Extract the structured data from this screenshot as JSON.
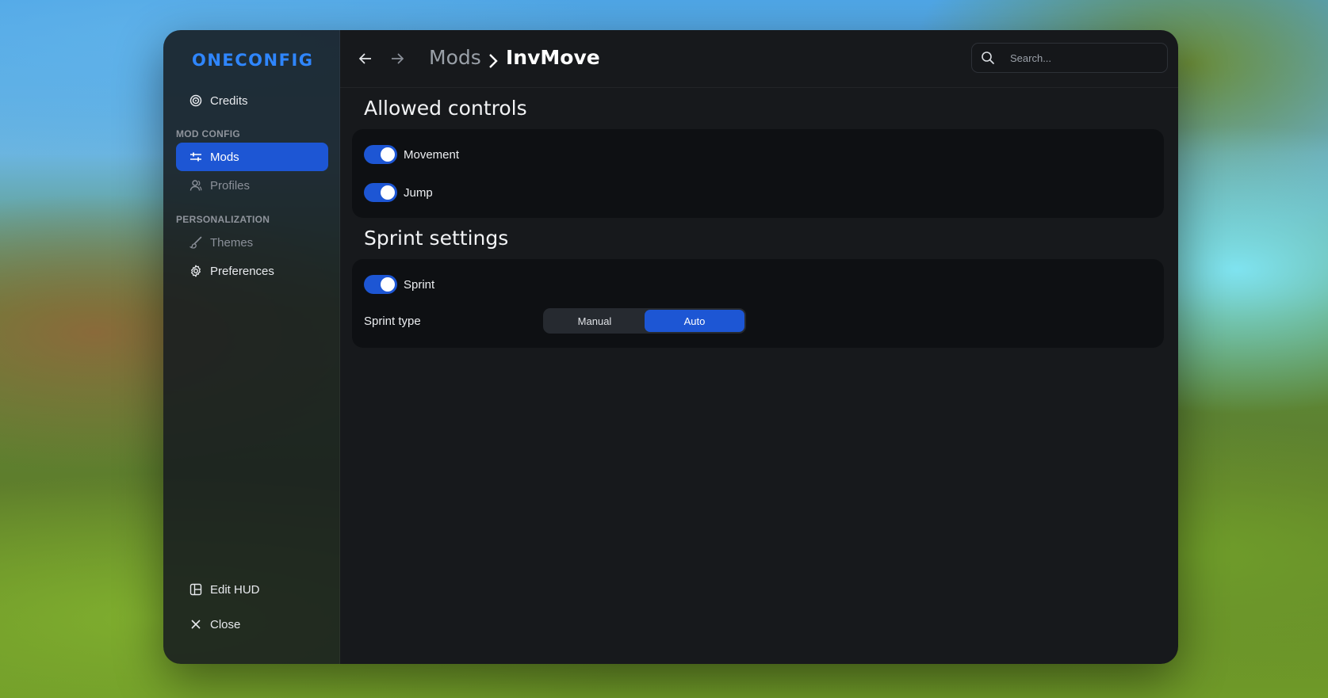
{
  "app": {
    "logo_text": "ONECONFIG",
    "accent_color": "#1d56d4"
  },
  "sidebar": {
    "credits": {
      "label": "Credits",
      "icon": "credits-icon"
    },
    "sections": [
      {
        "title": "MOD CONFIG"
      },
      {
        "title": "PERSONALIZATION"
      }
    ],
    "items": [
      {
        "label": "Mods",
        "icon": "sliders-icon",
        "active": true
      },
      {
        "label": "Profiles",
        "icon": "user-icon",
        "active": false
      },
      {
        "label": "Themes",
        "icon": "brush-icon",
        "active": false
      },
      {
        "label": "Preferences",
        "icon": "gear-icon",
        "active": false
      }
    ],
    "footer": [
      {
        "label": "Edit HUD",
        "icon": "layout-icon"
      },
      {
        "label": "Close",
        "icon": "close-icon"
      }
    ]
  },
  "topbar": {
    "breadcrumb": {
      "parent": "Mods",
      "separator": ">",
      "current": "InvMove"
    },
    "search": {
      "placeholder": "Search...",
      "value": ""
    }
  },
  "content": {
    "allowed_controls": {
      "title": "Allowed controls",
      "toggles": [
        {
          "label": "Movement",
          "on": true
        },
        {
          "label": "Jump",
          "on": true
        }
      ]
    },
    "sprint_settings": {
      "title": "Sprint settings",
      "toggle": {
        "label": "Sprint",
        "on": true
      },
      "sprint_type": {
        "label": "Sprint type",
        "options": [
          "Manual",
          "Auto"
        ],
        "selected": "Auto"
      }
    }
  }
}
